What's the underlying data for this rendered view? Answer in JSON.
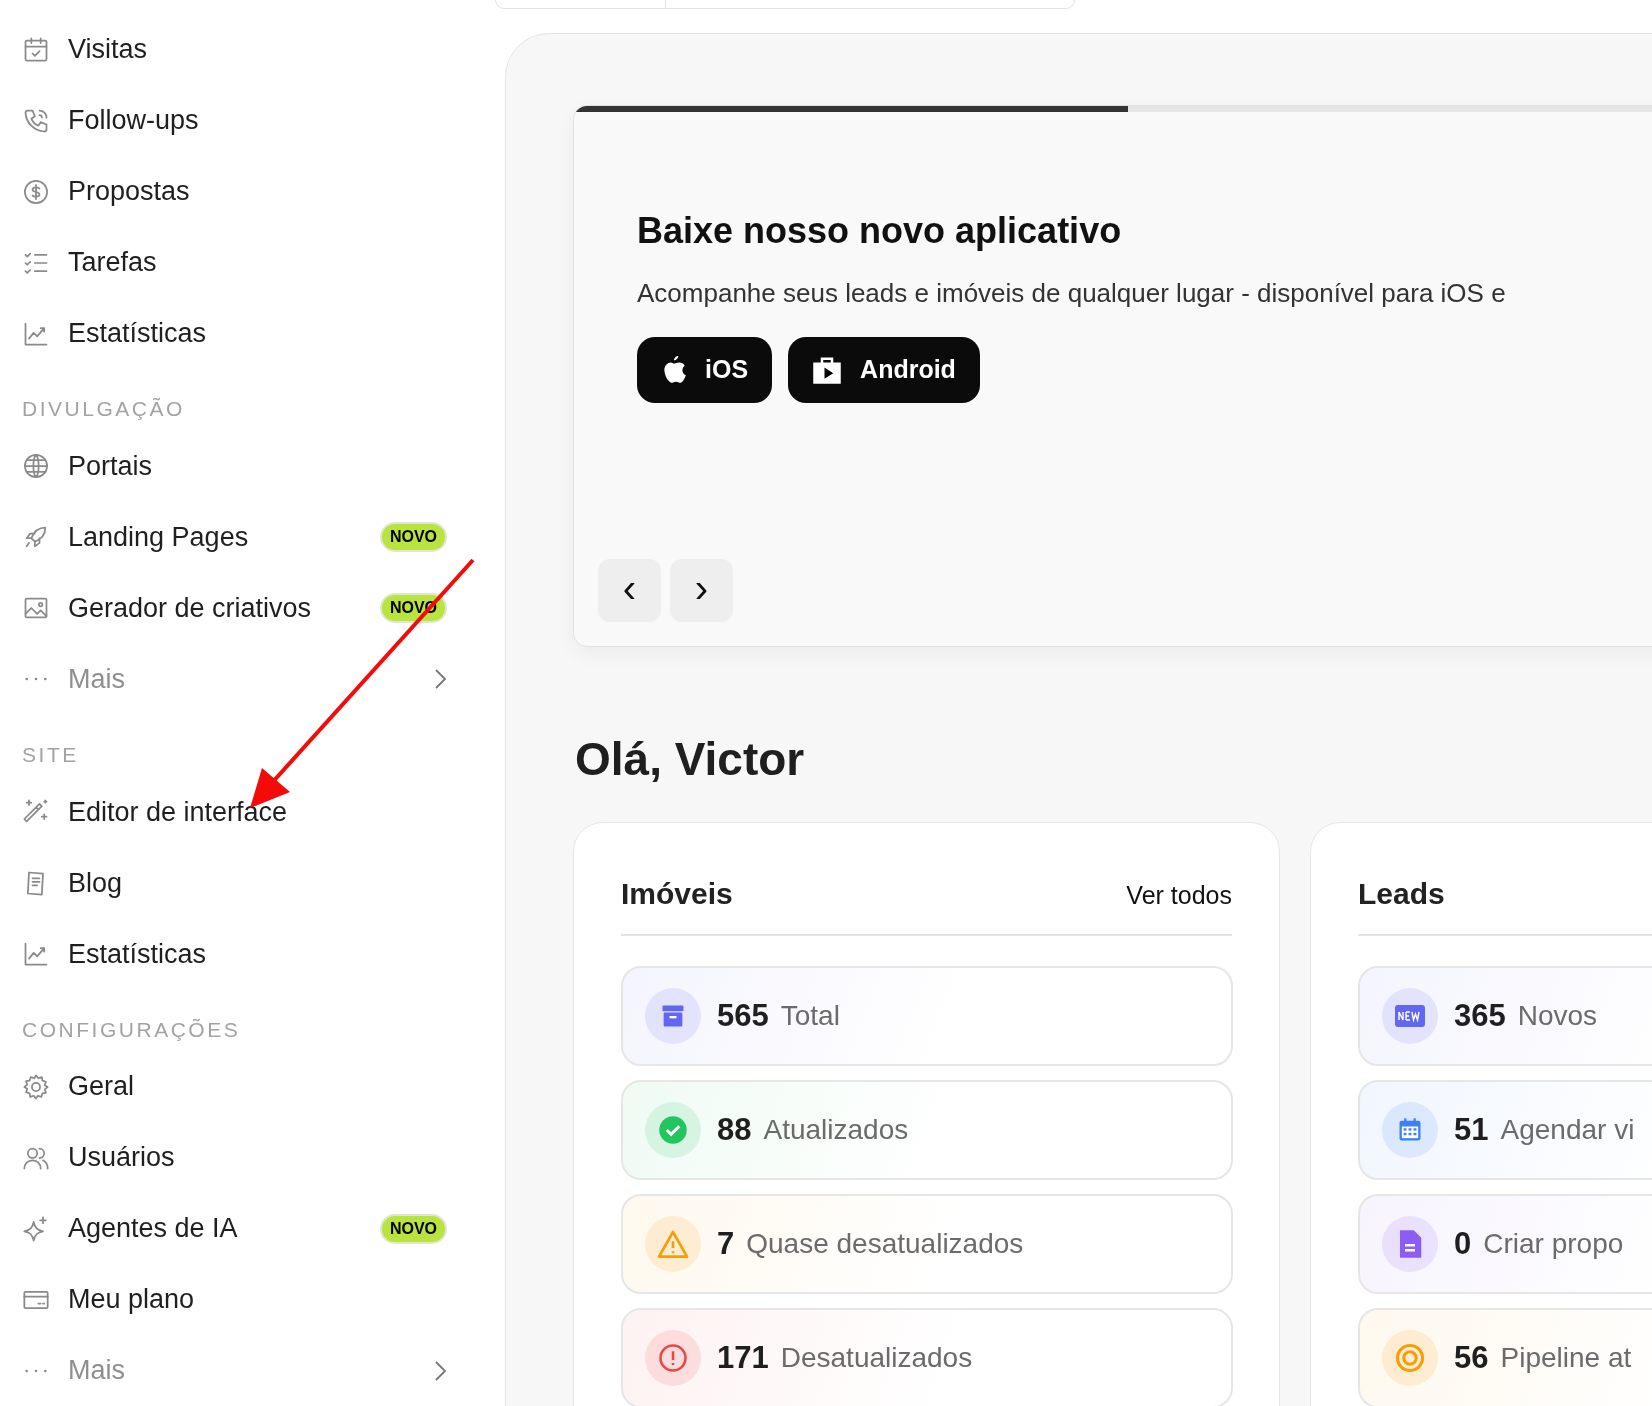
{
  "sidebar": {
    "sections": [
      {
        "items": [
          {
            "kind": "link",
            "label": "Visitas"
          },
          {
            "kind": "link",
            "label": "Follow-ups"
          },
          {
            "kind": "link",
            "label": "Propostas"
          },
          {
            "kind": "link",
            "label": "Tarefas"
          },
          {
            "kind": "link",
            "label": "Estatísticas"
          }
        ]
      },
      {
        "heading": "DIVULGAÇÃO",
        "items": [
          {
            "kind": "link",
            "label": "Portais"
          },
          {
            "kind": "link",
            "label": "Landing Pages",
            "badge": "NOVO"
          },
          {
            "kind": "link",
            "label": "Gerador de criativos",
            "badge": "NOVO"
          },
          {
            "kind": "more",
            "label": "Mais"
          }
        ]
      },
      {
        "heading": "SITE",
        "items": [
          {
            "kind": "link",
            "label": "Editor de interface"
          },
          {
            "kind": "link",
            "label": "Blog"
          },
          {
            "kind": "link",
            "label": "Estatísticas"
          }
        ]
      },
      {
        "heading": "CONFIGURAÇÕES",
        "items": [
          {
            "kind": "link",
            "label": "Geral"
          },
          {
            "kind": "link",
            "label": "Usuários"
          },
          {
            "kind": "link",
            "label": "Agentes de IA",
            "badge": "NOVO"
          },
          {
            "kind": "link",
            "label": "Meu plano"
          },
          {
            "kind": "more",
            "label": "Mais"
          }
        ]
      }
    ]
  },
  "banner": {
    "progress": {
      "level": 0.5
    },
    "title": "Baixe nosso novo aplicativo",
    "text": "Acompanhe seus leads e imóveis de qualquer lugar - disponível para iOS e",
    "buttons": [
      "iOS",
      "Android"
    ],
    "nav": [
      "‹",
      "›"
    ]
  },
  "greeting": "Olá, Victor",
  "cards": [
    {
      "title": "Imóveis",
      "link": "Ver todos",
      "stats": [
        {
          "value": "565",
          "label": "Total",
          "color": "#6366f1"
        },
        {
          "value": "88",
          "label": "Atualizados",
          "color": "#22c55e"
        },
        {
          "value": "7",
          "label": "Quase desatualizados",
          "color": "#f59e0b"
        },
        {
          "value": "171",
          "label": "Desatualizados",
          "color": "#ef4444"
        }
      ]
    },
    {
      "title": "Leads",
      "stats": [
        {
          "value": "365",
          "label": "Novos",
          "color": "#6366f1"
        },
        {
          "value": "51",
          "label": "Agendar vi",
          "color": "#3b82f6"
        },
        {
          "value": "0",
          "label": "Criar propo",
          "color": "#8b5cf6"
        },
        {
          "value": "56",
          "label": "Pipeline at",
          "color": "#f59e0b"
        }
      ]
    }
  ]
}
